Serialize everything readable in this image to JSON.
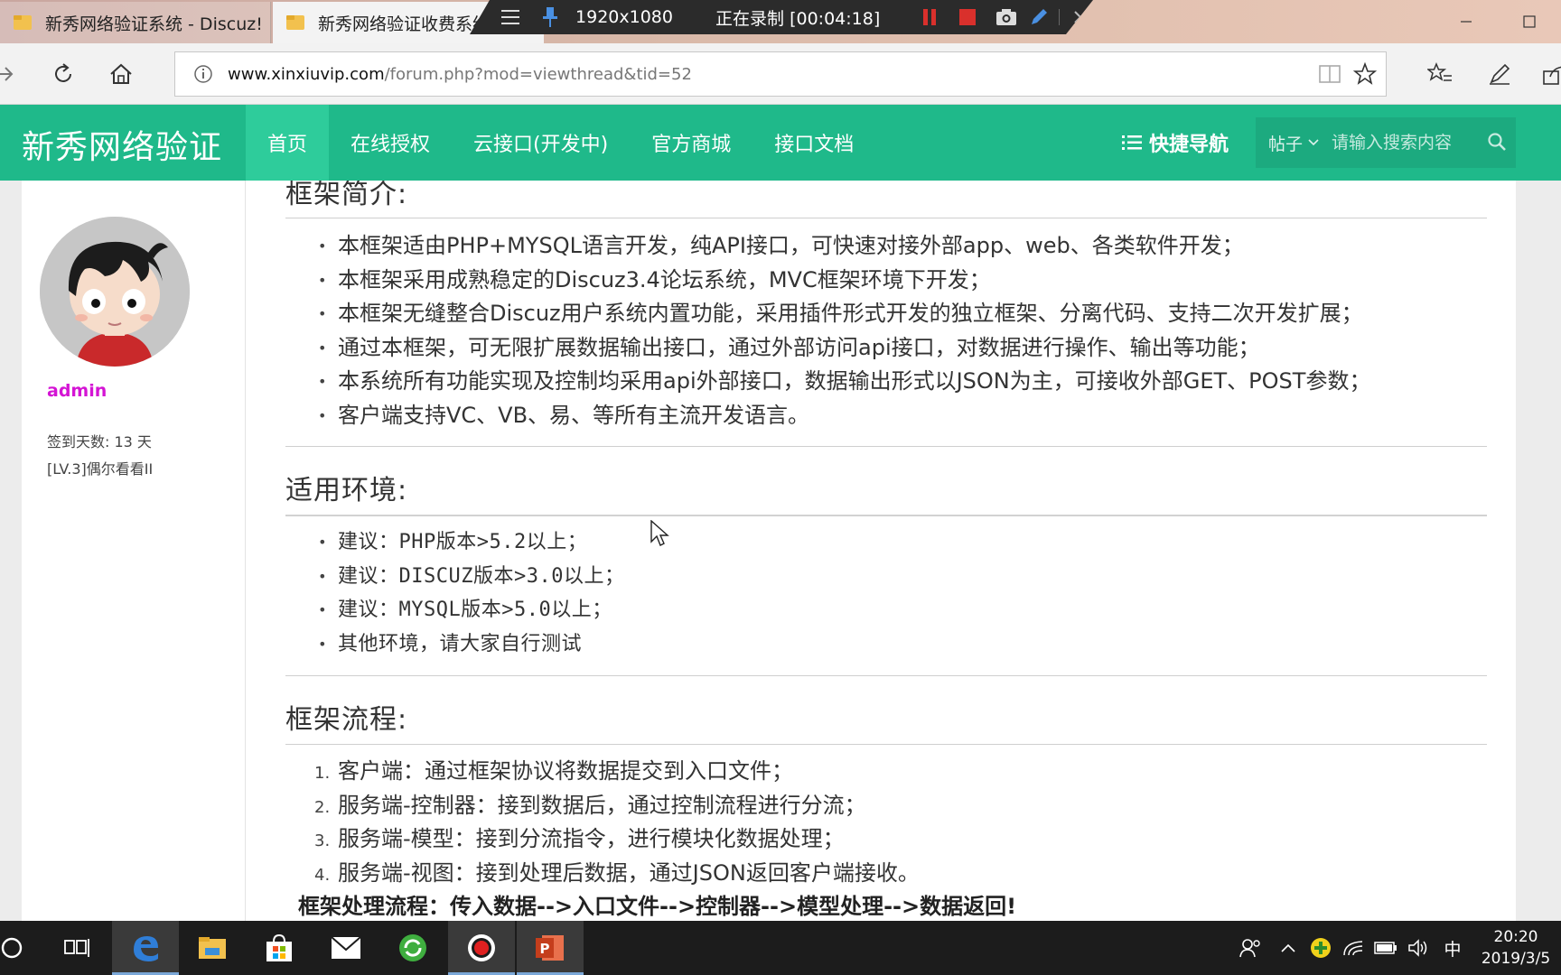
{
  "browser": {
    "tabs": [
      {
        "title": "新秀网络验证系统 - Discuz!",
        "active": false
      },
      {
        "title": "新秀网络验证收费系统",
        "active": true
      }
    ],
    "address": {
      "host": "www.xinxiuvip.com",
      "path": "/forum.php?mod=viewthread&tid=52"
    }
  },
  "recorder": {
    "resolution": "1920x1080",
    "status": "正在录制 [00:04:18]"
  },
  "site": {
    "logo": "新秀网络验证",
    "nav": [
      {
        "label": "首页",
        "active": true
      },
      {
        "label": "在线授权",
        "active": false
      },
      {
        "label": "云接口(开发中)",
        "active": false
      },
      {
        "label": "官方商城",
        "active": false
      },
      {
        "label": "接口文档",
        "active": false
      }
    ],
    "quick_nav": "快捷导航",
    "search": {
      "type": "帖子",
      "placeholder": "请输入搜索内容"
    }
  },
  "author": {
    "name": "admin",
    "checkin": "签到天数: 13 天",
    "level": "[LV.3]偶尔看看II"
  },
  "post": {
    "sections": [
      {
        "title": "框架简介:",
        "items": [
          "本框架适由PHP+MYSQL语言开发，纯API接口，可快速对接外部app、web、各类软件开发；",
          "本框架采用成熟稳定的Discuz3.4论坛系统，MVC框架环境下开发；",
          "本框架无缝整合Discuz用户系统内置功能，采用插件形式开发的独立框架、分离代码、支持二次开发扩展；",
          "通过本框架，可无限扩展数据输出接口，通过外部访问api接口，对数据进行操作、输出等功能；",
          "本系统所有功能实现及控制均采用api外部接口，数据输出形式以JSON为主，可接收外部GET、POST参数；",
          "客户端支持VC、VB、易、等所有主流开发语言。"
        ]
      },
      {
        "title": "适用环境:",
        "items": [
          "建议：PHP版本>5.2以上；",
          "建议：DISCUZ版本>3.0以上；",
          "建议：MYSQL版本>5.0以上；",
          "其他环境，请大家自行测试"
        ]
      },
      {
        "title": "框架流程:",
        "items": [
          {
            "n": "1.",
            "text": "客户端：通过框架协议将数据提交到入口文件；"
          },
          {
            "n": "2.",
            "text": "服务端-控制器：接到数据后，通过控制流程进行分流；"
          },
          {
            "n": "3.",
            "text": "服务端-模型：接到分流指令，进行模块化数据处理；"
          },
          {
            "n": "4.",
            "text": "服务端-视图：接到处理后数据，通过JSON返回客户端接收。"
          }
        ]
      }
    ],
    "flow": "框架处理流程：传入数据-->入口文件-->控制器-->模型处理-->数据返回!"
  },
  "taskbar": {
    "ime": "中",
    "time": "20:20",
    "date": "2019/3/5"
  },
  "colors": {
    "header": "#1fb98a",
    "nav_active": "#2ecc9b",
    "username": "#d414d4"
  }
}
